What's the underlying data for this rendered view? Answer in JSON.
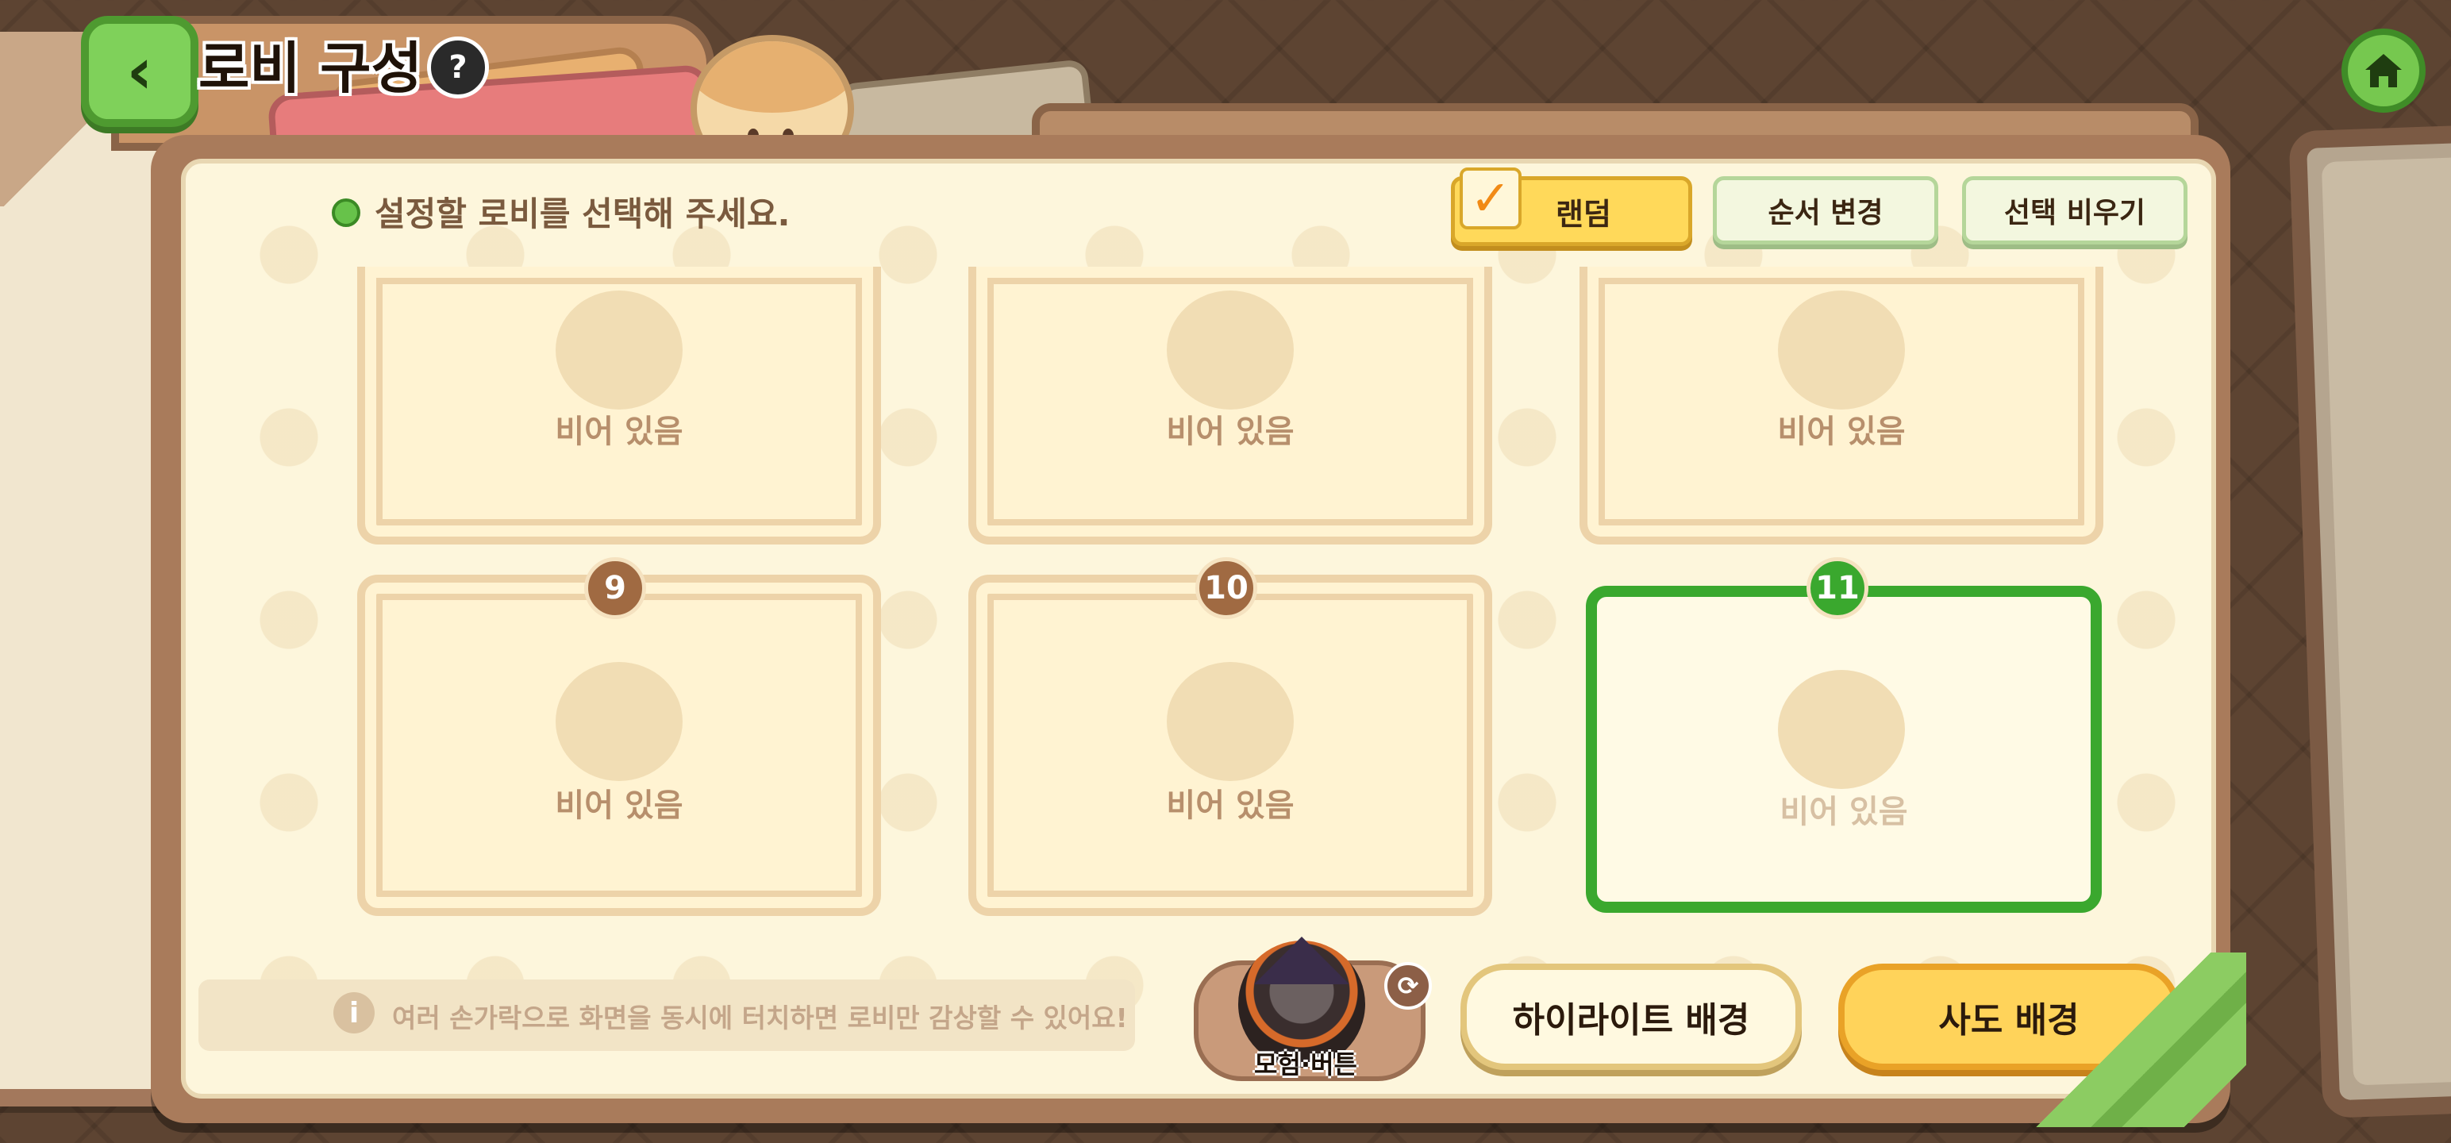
{
  "header": {
    "title": "로비 구성",
    "help_glyph": "?",
    "back_glyph": "‹"
  },
  "instruction": "설정할 로비를 선택해 주세요.",
  "toolbar": {
    "random_label": "랜덤",
    "random_checked": true,
    "order_label": "순서 변경",
    "clear_label": "선택 비우기"
  },
  "slots_top": [
    {
      "label": "비어 있음"
    },
    {
      "label": "비어 있음"
    },
    {
      "label": "비어 있음"
    }
  ],
  "slots_bottom": [
    {
      "number": "9",
      "label": "비어 있음",
      "selected": false
    },
    {
      "number": "10",
      "label": "비어 있음",
      "selected": false
    },
    {
      "number": "11",
      "label": "비어 있음",
      "selected": true
    }
  ],
  "tip": {
    "icon": "i",
    "text": "여러 손가락으로 화면을 동시에 터치하면 로비만 감상할 수 있어요!"
  },
  "character": {
    "name": "모험·버튼",
    "refresh_glyph": "⟳"
  },
  "bottom_buttons": {
    "highlight_label": "하이라이트 배경",
    "sado_label": "사도 배경"
  },
  "colors": {
    "accent_green": "#3aa82e",
    "random_yellow": "#ffd95a",
    "panel_bg": "#fdf6dc"
  }
}
